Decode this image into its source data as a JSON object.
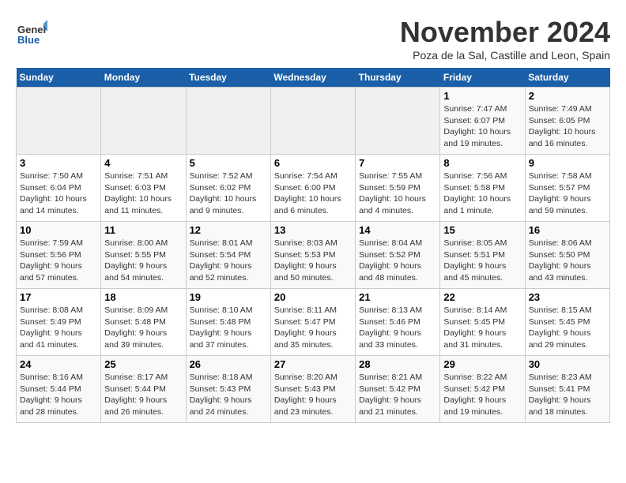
{
  "logo": {
    "general": "General",
    "blue": "Blue"
  },
  "header": {
    "month_year": "November 2024",
    "location": "Poza de la Sal, Castille and Leon, Spain"
  },
  "weekdays": [
    "Sunday",
    "Monday",
    "Tuesday",
    "Wednesday",
    "Thursday",
    "Friday",
    "Saturday"
  ],
  "weeks": [
    [
      {
        "day": "",
        "info": ""
      },
      {
        "day": "",
        "info": ""
      },
      {
        "day": "",
        "info": ""
      },
      {
        "day": "",
        "info": ""
      },
      {
        "day": "",
        "info": ""
      },
      {
        "day": "1",
        "info": "Sunrise: 7:47 AM\nSunset: 6:07 PM\nDaylight: 10 hours and 19 minutes."
      },
      {
        "day": "2",
        "info": "Sunrise: 7:49 AM\nSunset: 6:05 PM\nDaylight: 10 hours and 16 minutes."
      }
    ],
    [
      {
        "day": "3",
        "info": "Sunrise: 7:50 AM\nSunset: 6:04 PM\nDaylight: 10 hours and 14 minutes."
      },
      {
        "day": "4",
        "info": "Sunrise: 7:51 AM\nSunset: 6:03 PM\nDaylight: 10 hours and 11 minutes."
      },
      {
        "day": "5",
        "info": "Sunrise: 7:52 AM\nSunset: 6:02 PM\nDaylight: 10 hours and 9 minutes."
      },
      {
        "day": "6",
        "info": "Sunrise: 7:54 AM\nSunset: 6:00 PM\nDaylight: 10 hours and 6 minutes."
      },
      {
        "day": "7",
        "info": "Sunrise: 7:55 AM\nSunset: 5:59 PM\nDaylight: 10 hours and 4 minutes."
      },
      {
        "day": "8",
        "info": "Sunrise: 7:56 AM\nSunset: 5:58 PM\nDaylight: 10 hours and 1 minute."
      },
      {
        "day": "9",
        "info": "Sunrise: 7:58 AM\nSunset: 5:57 PM\nDaylight: 9 hours and 59 minutes."
      }
    ],
    [
      {
        "day": "10",
        "info": "Sunrise: 7:59 AM\nSunset: 5:56 PM\nDaylight: 9 hours and 57 minutes."
      },
      {
        "day": "11",
        "info": "Sunrise: 8:00 AM\nSunset: 5:55 PM\nDaylight: 9 hours and 54 minutes."
      },
      {
        "day": "12",
        "info": "Sunrise: 8:01 AM\nSunset: 5:54 PM\nDaylight: 9 hours and 52 minutes."
      },
      {
        "day": "13",
        "info": "Sunrise: 8:03 AM\nSunset: 5:53 PM\nDaylight: 9 hours and 50 minutes."
      },
      {
        "day": "14",
        "info": "Sunrise: 8:04 AM\nSunset: 5:52 PM\nDaylight: 9 hours and 48 minutes."
      },
      {
        "day": "15",
        "info": "Sunrise: 8:05 AM\nSunset: 5:51 PM\nDaylight: 9 hours and 45 minutes."
      },
      {
        "day": "16",
        "info": "Sunrise: 8:06 AM\nSunset: 5:50 PM\nDaylight: 9 hours and 43 minutes."
      }
    ],
    [
      {
        "day": "17",
        "info": "Sunrise: 8:08 AM\nSunset: 5:49 PM\nDaylight: 9 hours and 41 minutes."
      },
      {
        "day": "18",
        "info": "Sunrise: 8:09 AM\nSunset: 5:48 PM\nDaylight: 9 hours and 39 minutes."
      },
      {
        "day": "19",
        "info": "Sunrise: 8:10 AM\nSunset: 5:48 PM\nDaylight: 9 hours and 37 minutes."
      },
      {
        "day": "20",
        "info": "Sunrise: 8:11 AM\nSunset: 5:47 PM\nDaylight: 9 hours and 35 minutes."
      },
      {
        "day": "21",
        "info": "Sunrise: 8:13 AM\nSunset: 5:46 PM\nDaylight: 9 hours and 33 minutes."
      },
      {
        "day": "22",
        "info": "Sunrise: 8:14 AM\nSunset: 5:45 PM\nDaylight: 9 hours and 31 minutes."
      },
      {
        "day": "23",
        "info": "Sunrise: 8:15 AM\nSunset: 5:45 PM\nDaylight: 9 hours and 29 minutes."
      }
    ],
    [
      {
        "day": "24",
        "info": "Sunrise: 8:16 AM\nSunset: 5:44 PM\nDaylight: 9 hours and 28 minutes."
      },
      {
        "day": "25",
        "info": "Sunrise: 8:17 AM\nSunset: 5:44 PM\nDaylight: 9 hours and 26 minutes."
      },
      {
        "day": "26",
        "info": "Sunrise: 8:18 AM\nSunset: 5:43 PM\nDaylight: 9 hours and 24 minutes."
      },
      {
        "day": "27",
        "info": "Sunrise: 8:20 AM\nSunset: 5:43 PM\nDaylight: 9 hours and 23 minutes."
      },
      {
        "day": "28",
        "info": "Sunrise: 8:21 AM\nSunset: 5:42 PM\nDaylight: 9 hours and 21 minutes."
      },
      {
        "day": "29",
        "info": "Sunrise: 8:22 AM\nSunset: 5:42 PM\nDaylight: 9 hours and 19 minutes."
      },
      {
        "day": "30",
        "info": "Sunrise: 8:23 AM\nSunset: 5:41 PM\nDaylight: 9 hours and 18 minutes."
      }
    ]
  ]
}
